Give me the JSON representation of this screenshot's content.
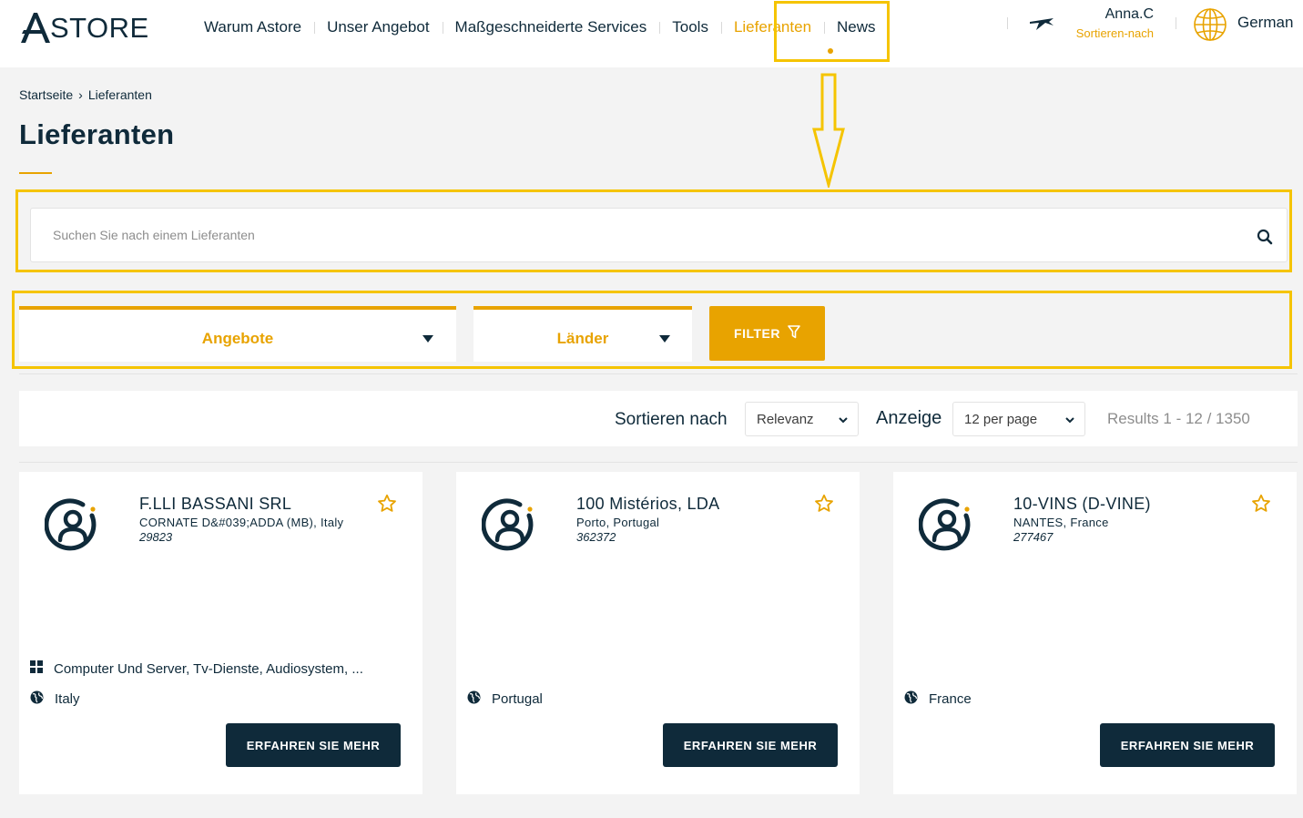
{
  "brand": {
    "logo_text": "STORE",
    "accent_color": "#e8a300",
    "highlight_color": "#f5c400",
    "dark_color": "#0f2a3a"
  },
  "nav": {
    "items": [
      {
        "label": "Warum Astore"
      },
      {
        "label": "Unser Angebot"
      },
      {
        "label": "Maßgeschneiderte Services"
      },
      {
        "label": "Tools"
      },
      {
        "label": "Lieferanten",
        "active": true
      },
      {
        "label": "News"
      }
    ]
  },
  "user": {
    "name": "Anna.C",
    "subtitle": "Sortieren-nach",
    "icon": "plane-icon"
  },
  "language": {
    "label": "German",
    "icon": "globe-icon"
  },
  "breadcrumb": {
    "home": "Startseite",
    "separator": "›",
    "current": "Lieferanten"
  },
  "page": {
    "title": "Lieferanten"
  },
  "search": {
    "placeholder": "Suchen Sie nach einem Lieferanten",
    "value": "",
    "icon": "search-icon"
  },
  "filters": {
    "offers_label": "Angebote",
    "countries_label": "Länder",
    "filter_button": "FILTER",
    "filter_icon": "funnel-icon"
  },
  "sortbar": {
    "sort_label": "Sortieren nach",
    "sort_value": "Relevanz",
    "show_label": "Anzeige",
    "per_page_value": "12 per page",
    "results_text": "Results 1 - 12 / 1350"
  },
  "cards": [
    {
      "name": "F.LLI BASSANI SRL",
      "location": "CORNATE D&#039;ADDA (MB), Italy",
      "id": "29823",
      "categories": "Computer Und Server, Tv-Dienste, Audiosystem, ...",
      "country": "Italy",
      "button": "ERFAHREN SIE MEHR"
    },
    {
      "name": "100 Mistérios, LDA",
      "location": "Porto, Portugal",
      "id": "362372",
      "categories": "",
      "country": "Portugal",
      "button": "ERFAHREN SIE MEHR"
    },
    {
      "name": "10-VINS (D-VINE)",
      "location": "NANTES, France",
      "id": "277467",
      "categories": "",
      "country": "France",
      "button": "ERFAHREN SIE MEHR"
    }
  ]
}
